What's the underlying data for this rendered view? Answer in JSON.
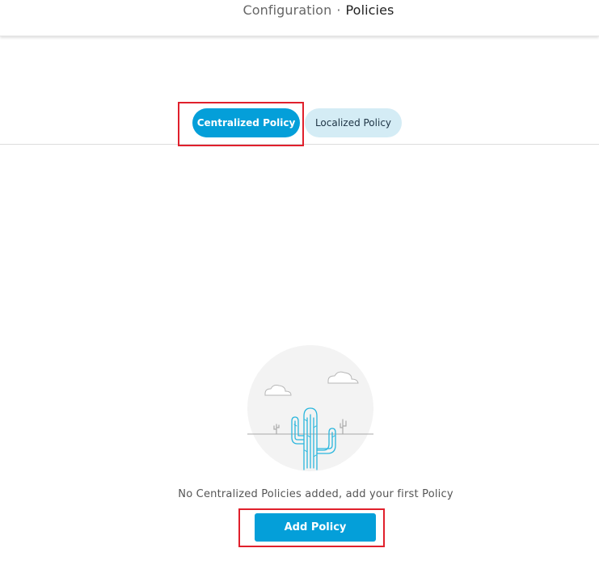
{
  "header": {
    "breadcrumb_parent": "Configuration",
    "breadcrumb_separator": "·",
    "breadcrumb_current": "Policies"
  },
  "tabs": [
    {
      "label": "Centralized Policy",
      "active": true
    },
    {
      "label": "Localized Policy",
      "active": false
    }
  ],
  "empty_state": {
    "illustration": "cactus-desert-icon",
    "message": "No Centralized Policies added, add your first Policy",
    "button_label": "Add Policy"
  },
  "colors": {
    "accent": "#049fd9",
    "tab_inactive_bg": "#d4ecf5",
    "highlight": "#e0202c"
  }
}
